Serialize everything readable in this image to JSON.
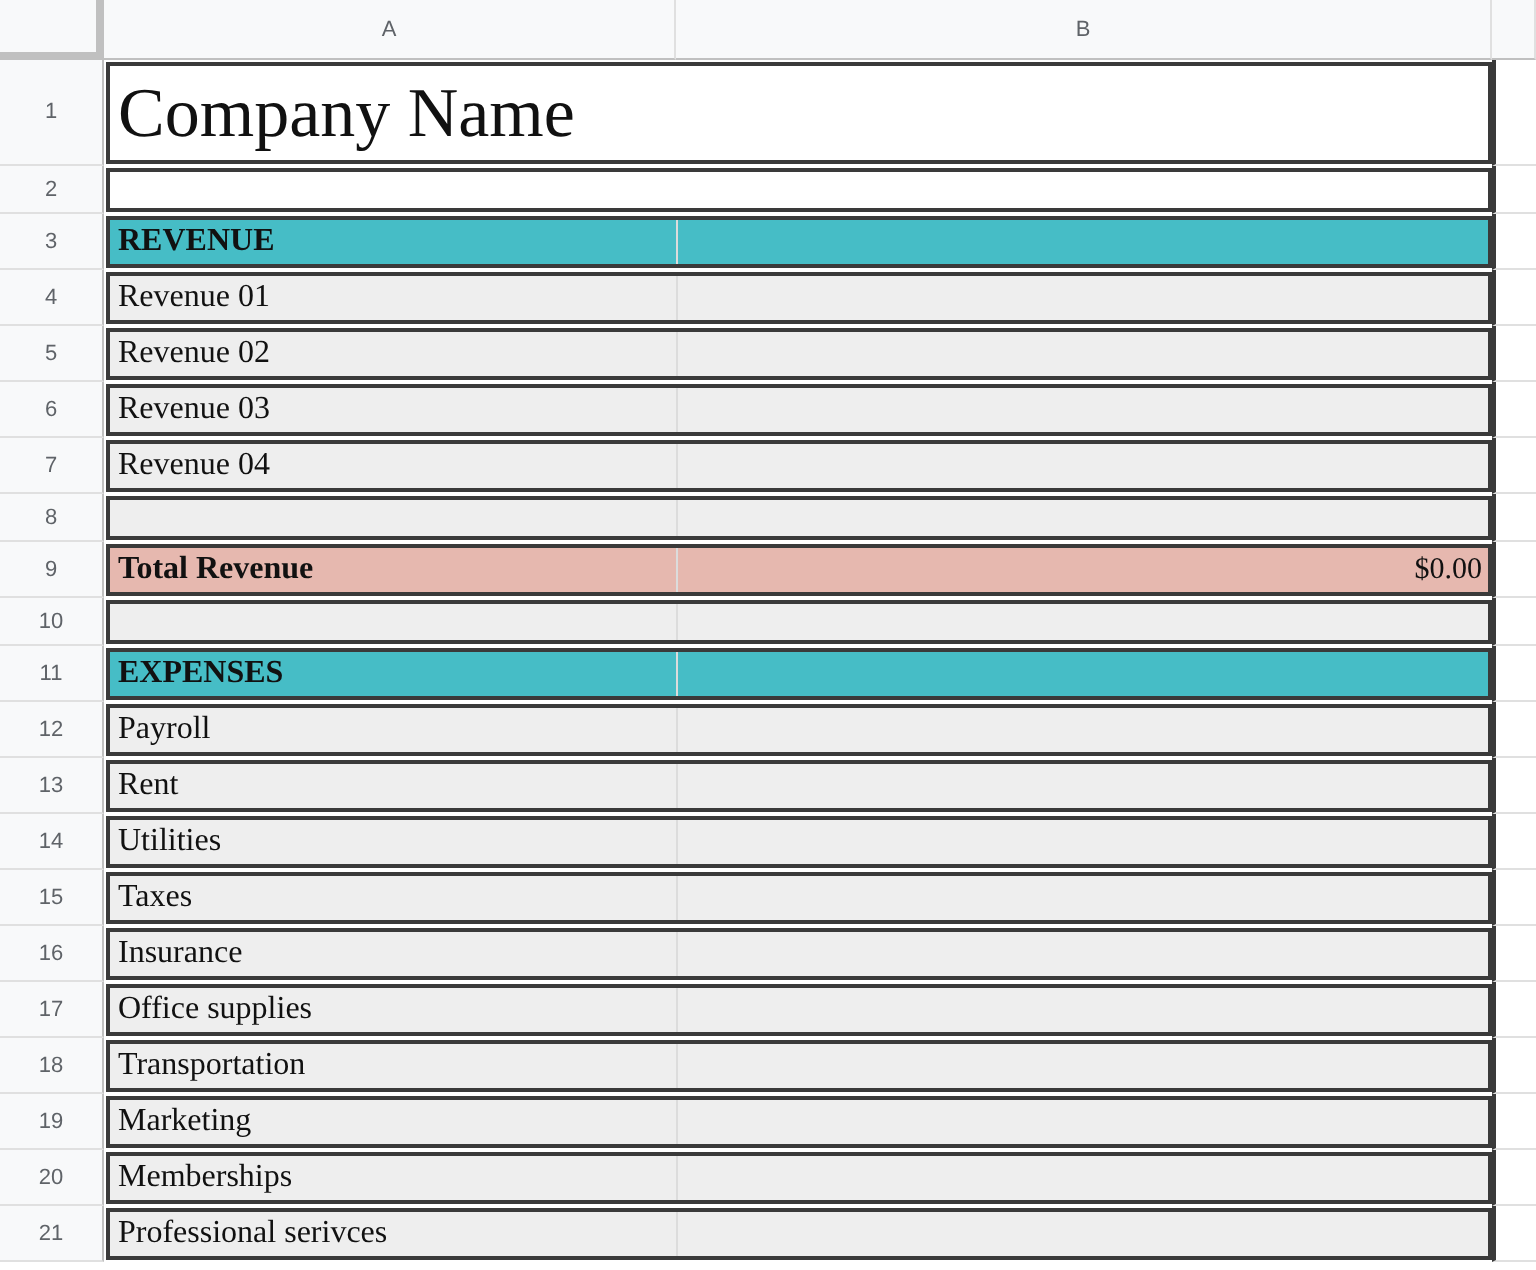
{
  "columns": [
    "A",
    "B"
  ],
  "rows": [
    {
      "number": "1",
      "kind": "title",
      "label": "Company Name"
    },
    {
      "number": "2",
      "kind": "blank"
    },
    {
      "number": "3",
      "kind": "section",
      "label": "REVENUE"
    },
    {
      "number": "4",
      "kind": "item",
      "label": "Revenue 01"
    },
    {
      "number": "5",
      "kind": "item",
      "label": "Revenue 02"
    },
    {
      "number": "6",
      "kind": "item",
      "label": "Revenue 03"
    },
    {
      "number": "7",
      "kind": "item",
      "label": "Revenue 04"
    },
    {
      "number": "8",
      "kind": "spacer"
    },
    {
      "number": "9",
      "kind": "total",
      "label": "Total Revenue",
      "value": "$0.00"
    },
    {
      "number": "10",
      "kind": "spacer"
    },
    {
      "number": "11",
      "kind": "section",
      "label": "EXPENSES"
    },
    {
      "number": "12",
      "kind": "item",
      "label": "Payroll"
    },
    {
      "number": "13",
      "kind": "item",
      "label": "Rent"
    },
    {
      "number": "14",
      "kind": "item",
      "label": "Utilities"
    },
    {
      "number": "15",
      "kind": "item",
      "label": "Taxes"
    },
    {
      "number": "16",
      "kind": "item",
      "label": "Insurance"
    },
    {
      "number": "17",
      "kind": "item",
      "label": "Office supplies"
    },
    {
      "number": "18",
      "kind": "item",
      "label": "Transportation"
    },
    {
      "number": "19",
      "kind": "item",
      "label": "Marketing"
    },
    {
      "number": "20",
      "kind": "item",
      "label": "Memberships"
    },
    {
      "number": "21",
      "kind": "item",
      "label": "Professional serivces"
    }
  ]
}
